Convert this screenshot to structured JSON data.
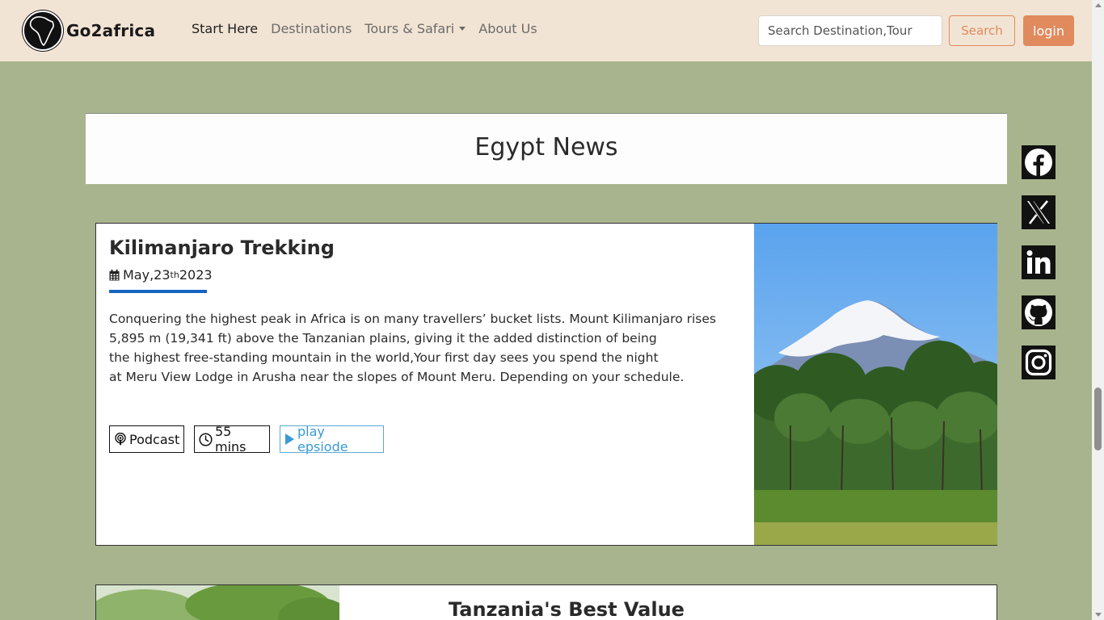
{
  "navbar": {
    "brand_name": "Go2africa",
    "links": [
      {
        "label": "Start Here",
        "active": true
      },
      {
        "label": "Destinations",
        "active": false
      },
      {
        "label": "Tours & Safari",
        "active": false,
        "dropdown": true
      },
      {
        "label": "About Us",
        "active": false
      }
    ],
    "search_placeholder": "Search Destination,Tour",
    "search_label": "Search",
    "login_label": "login"
  },
  "banner": {
    "title": "Egypt News"
  },
  "article": {
    "title": "Kilimanjaro Trekking",
    "date_prefix": "May,23",
    "date_suffix": "th",
    "date_year": " 2023",
    "body_lines": [
      "Conquering the highest peak in Africa is on many travellers’ bucket lists. Mount Kilimanjaro rises",
      "5,895 m (19,341 ft) above the Tanzanian plains, giving it the added distinction of being",
      "the highest free-standing mountain in the world,Your first day sees you spend the night",
      "at Meru View Lodge in Arusha near the slopes of Mount Meru. Depending on your schedule."
    ],
    "tag_podcast": "Podcast",
    "tag_duration": "55 mins",
    "tag_play": "play epsiode"
  },
  "article2": {
    "title": "Tanzania's Best Value"
  },
  "social": [
    "facebook-icon",
    "x-icon",
    "linkedin-icon",
    "github-icon",
    "instagram-icon"
  ],
  "colors": {
    "page_bg": "#a8b48e",
    "nav_bg": "#f2e4d4",
    "accent": "#e08a5e",
    "date_underline": "#1565c0",
    "play_link": "#3a9ad6"
  }
}
